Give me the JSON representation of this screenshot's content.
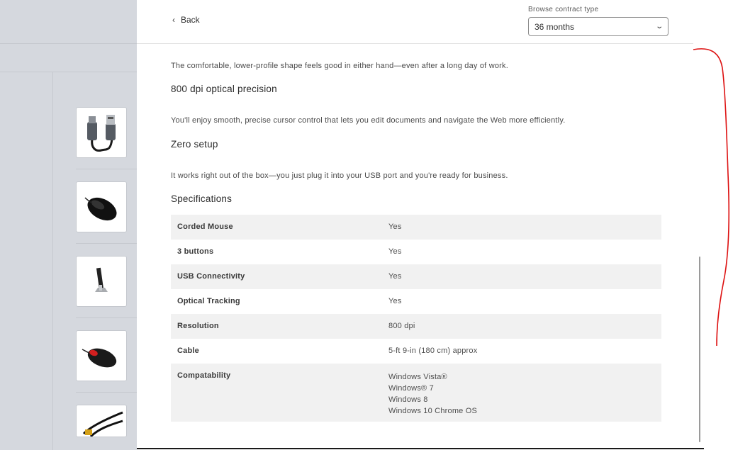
{
  "header": {
    "back_label": "Back",
    "contract_label": "Browse contract type",
    "contract_value": "36 months"
  },
  "content": {
    "intro_text": "The comfortable, lower-profile shape feels good in either hand—even after a long day of work.",
    "sections": [
      {
        "heading": "800 dpi optical precision",
        "text": "You'll enjoy smooth, precise cursor control that lets you edit documents and navigate the Web more efficiently."
      },
      {
        "heading": "Zero setup",
        "text": "It works right out of the box—you just plug it into your USB port and you're ready for business."
      }
    ],
    "specs_heading": "Specifications",
    "specs": [
      {
        "key": "Corded Mouse",
        "value": [
          "Yes"
        ]
      },
      {
        "key": "3 buttons",
        "value": [
          "Yes"
        ]
      },
      {
        "key": "USB Connectivity",
        "value": [
          "Yes"
        ]
      },
      {
        "key": "Optical Tracking",
        "value": [
          "Yes"
        ]
      },
      {
        "key": "Resolution",
        "value": [
          "800 dpi"
        ]
      },
      {
        "key": "Cable",
        "value": [
          "5-ft 9-in (180 cm) approx"
        ]
      },
      {
        "key": "Compatability",
        "value": [
          "Windows Vista®",
          "Windows® 7",
          "Windows 8",
          "Windows 10 Chrome OS"
        ]
      }
    ]
  },
  "thumbnails": [
    {
      "name": "usb-cable-thumbnail"
    },
    {
      "name": "black-mouse-thumbnail"
    },
    {
      "name": "phone-stand-thumbnail"
    },
    {
      "name": "red-black-mouse-thumbnail"
    },
    {
      "name": "hdmi-cable-thumbnail"
    }
  ],
  "colors": {
    "left_pane": "#d5d8de",
    "table_stripe": "#f1f1f1",
    "annotation": "#dd1111"
  }
}
